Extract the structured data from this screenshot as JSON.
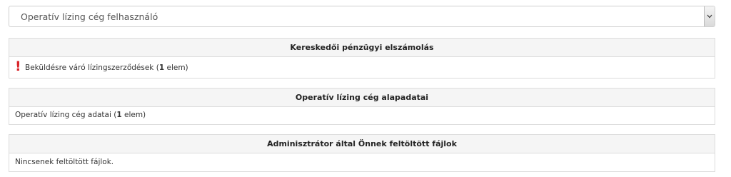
{
  "role_select": {
    "selected_value": "Operatív lízing cég felhasználó",
    "toggle_icon": "chevron-down-icon"
  },
  "panels": [
    {
      "title": "Kereskedői pénzügyi elszámolás",
      "warning_icon": "exclamation-icon",
      "warning_color": "#d9252a",
      "item_label": "Beküldésre váró lízingszerződések (",
      "item_count": "1",
      "item_suffix": " elem)"
    },
    {
      "title": "Operatív lízing cég alapadatai",
      "item_label": "Operatív lízing cég adatai (",
      "item_count": "1",
      "item_suffix": " elem)"
    },
    {
      "title": "Adminisztrátor által Önnek feltöltött fájlok",
      "empty_text": "Nincsenek feltöltött fájlok."
    }
  ]
}
